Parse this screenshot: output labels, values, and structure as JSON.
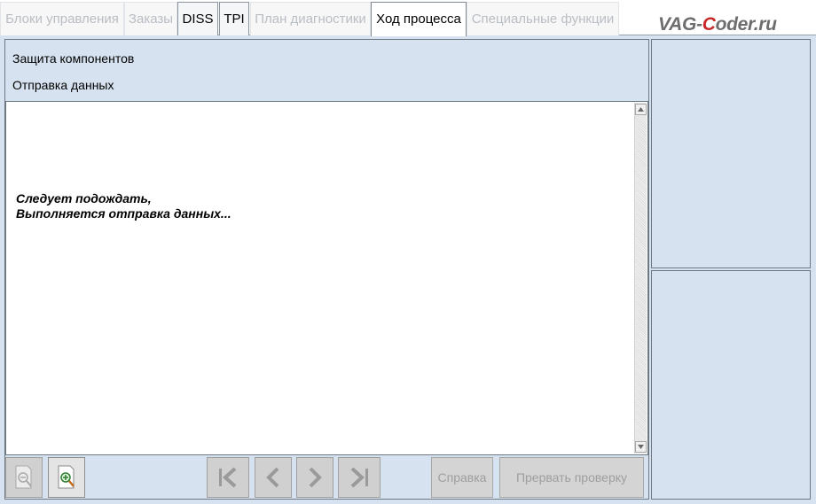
{
  "tabs": [
    {
      "label": "Блоки управления",
      "state": "disabled"
    },
    {
      "label": "Заказы",
      "state": "disabled"
    },
    {
      "label": "DISS",
      "state": "enabled"
    },
    {
      "label": "TPI",
      "state": "enabled"
    },
    {
      "label": "План диагностики",
      "state": "disabled"
    },
    {
      "label": "Ход процесса",
      "state": "active"
    },
    {
      "label": "Специальные функции",
      "state": "disabled"
    }
  ],
  "watermark": {
    "prefix": "VAG-",
    "letter": "C",
    "suffix": "oder.ru",
    "letter_color": "#c62828"
  },
  "header": {
    "line1": "Защита компонентов",
    "line2": "Отправка данных"
  },
  "message": {
    "line1": "Следует подождать,",
    "line2": "Выполняется отправка данных..."
  },
  "toolbar": {
    "icons": [
      "zoom-out-icon",
      "zoom-in-icon",
      "first-icon",
      "previous-icon",
      "next-icon",
      "last-icon"
    ],
    "help_label": "Справка",
    "abort_label": "Прервать проверку"
  },
  "colors": {
    "panel_bg": "#d6e2ef",
    "border": "#6e7883",
    "disabled_text": "#9e9e9e"
  }
}
